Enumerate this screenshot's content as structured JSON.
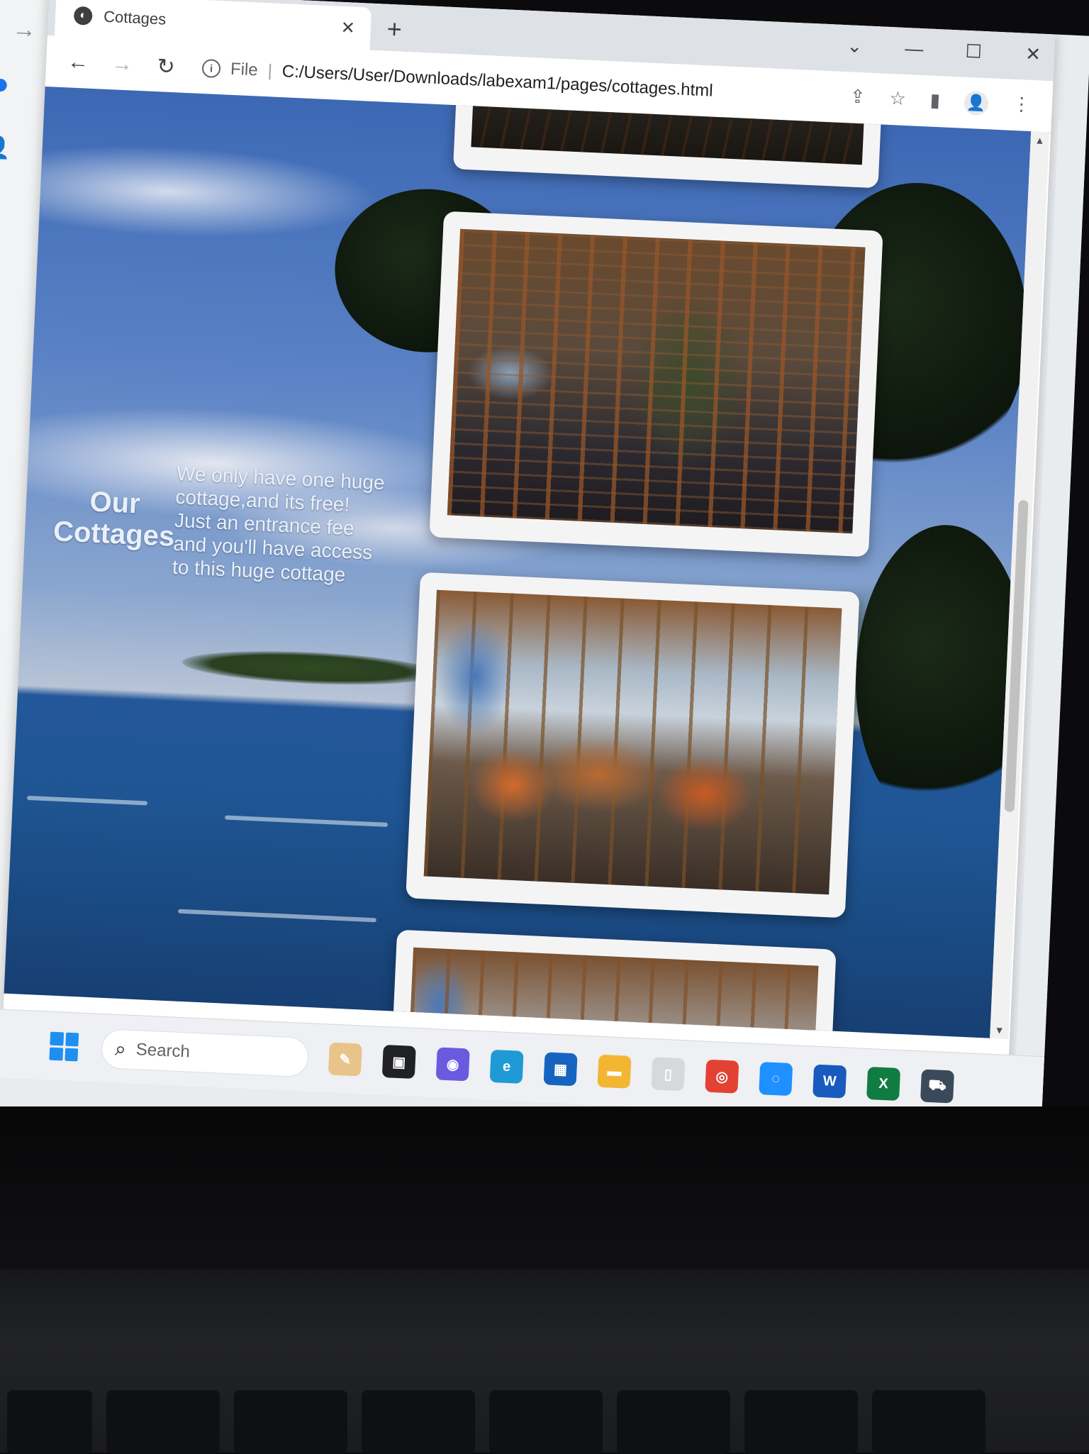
{
  "browser": {
    "tab_title": "Cottages",
    "tab_close": "✕",
    "new_tab": "+",
    "window_controls": {
      "dropdown": "⌄",
      "minimize": "—",
      "maximize": "☐",
      "close": "✕"
    },
    "nav": {
      "back": "←",
      "forward": "→",
      "reload": "↻"
    },
    "omnibox": {
      "info_icon": "i",
      "scheme_label": "File",
      "separator": "|",
      "url": "C:/Users/User/Downloads/labexam1/pages/cottages.html"
    },
    "actions": {
      "share": "⇪",
      "bookmark": "☆",
      "side_panel": "▮",
      "profile": "👤",
      "menu": "⋮"
    }
  },
  "page": {
    "heading": "Our Cottages",
    "intro": "We only have one huge cottage,and its free! Just an entrance fee and you'll have access to this huge cottage"
  },
  "taskbar": {
    "search_label": "Search",
    "apps": [
      {
        "name": "notepad",
        "label": "✎",
        "color": "#e8c48a"
      },
      {
        "name": "task-view",
        "label": "▣",
        "color": "#202124"
      },
      {
        "name": "chat",
        "label": "◉",
        "color": "#6a5ae0"
      },
      {
        "name": "edge",
        "label": "e",
        "color": "#1f9ad6"
      },
      {
        "name": "store",
        "label": "▦",
        "color": "#1565c0"
      },
      {
        "name": "file-explorer",
        "label": "▬",
        "color": "#f2b632"
      },
      {
        "name": "blank-file",
        "label": "▯",
        "color": "#d6d8da"
      },
      {
        "name": "chrome",
        "label": "◎",
        "color": "#e34133"
      },
      {
        "name": "messenger",
        "label": "◌",
        "color": "#1e90ff"
      },
      {
        "name": "word",
        "label": "W",
        "color": "#185abd"
      },
      {
        "name": "excel",
        "label": "X",
        "color": "#107c41"
      },
      {
        "name": "car-app",
        "label": "⛟",
        "color": "#3a4a5a"
      }
    ]
  },
  "colors": {
    "chrome_bg": "#dee1e6",
    "sky": "#3c68b4",
    "sea": "#1e5592",
    "card": "#f4f4f4",
    "heading_text": "#e8f0fb"
  }
}
